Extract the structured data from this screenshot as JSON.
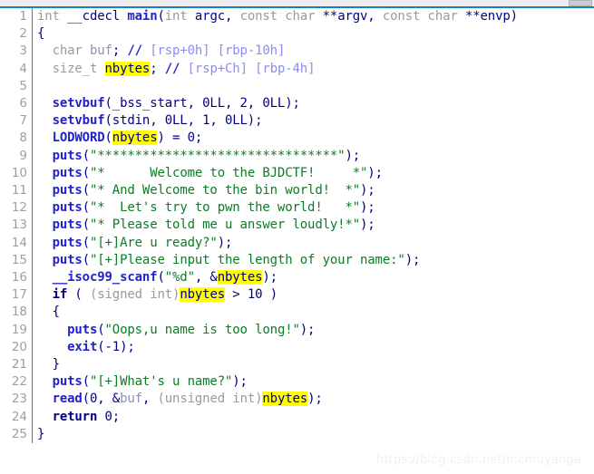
{
  "window": {
    "scrollbar_present": true,
    "accent_color": "#1a7fc1",
    "gutter_divider_color": "#3f7fd0",
    "highlight_color": "#ffff00",
    "background_color": "#ffffff"
  },
  "watermark": {
    "text": "https://blog.csdn.net/mcmuyanga"
  },
  "editor": {
    "highlighted_token": "nbytes",
    "line_count": 25,
    "lines": [
      {
        "number": "1",
        "text": "int __cdecl main(int argc, const char **argv, const char **envp)"
      },
      {
        "number": "2",
        "text": "{"
      },
      {
        "number": "3",
        "text": "  char buf; // [rsp+0h] [rbp-10h]"
      },
      {
        "number": "4",
        "text": "  size_t nbytes; // [rsp+Ch] [rbp-4h]"
      },
      {
        "number": "5",
        "text": ""
      },
      {
        "number": "6",
        "text": "  setvbuf(_bss_start, 0LL, 2, 0LL);"
      },
      {
        "number": "7",
        "text": "  setvbuf(stdin, 0LL, 1, 0LL);"
      },
      {
        "number": "8",
        "text": "  LODWORD(nbytes) = 0;"
      },
      {
        "number": "9",
        "text": "  puts(\"********************************\");"
      },
      {
        "number": "10",
        "text": "  puts(\"*      Welcome to the BJDCTF!     *\");"
      },
      {
        "number": "11",
        "text": "  puts(\"* And Welcome to the bin world!  *\");"
      },
      {
        "number": "12",
        "text": "  puts(\"*  Let's try to pwn the world!   *\");"
      },
      {
        "number": "13",
        "text": "  puts(\"* Please told me u answer loudly!*\");"
      },
      {
        "number": "14",
        "text": "  puts(\"[+]Are u ready?\");"
      },
      {
        "number": "15",
        "text": "  puts(\"[+]Please input the length of your name:\");"
      },
      {
        "number": "16",
        "text": "  __isoc99_scanf(\"%d\", &nbytes);"
      },
      {
        "number": "17",
        "text": "  if ( (signed int)nbytes > 10 )"
      },
      {
        "number": "18",
        "text": "  {"
      },
      {
        "number": "19",
        "text": "    puts(\"Oops,u name is too long!\");"
      },
      {
        "number": "20",
        "text": "    exit(-1);"
      },
      {
        "number": "21",
        "text": "  }"
      },
      {
        "number": "22",
        "text": "  puts(\"[+]What's u name?\");"
      },
      {
        "number": "23",
        "text": "  read(0, &buf, (unsigned int)nbytes);"
      },
      {
        "number": "24",
        "text": "  return 0;"
      },
      {
        "number": "25",
        "text": "}"
      }
    ],
    "numbers": [
      "1",
      "2",
      "3",
      "4",
      "5",
      "6",
      "7",
      "8",
      "9",
      "10",
      "11",
      "12",
      "13",
      "14",
      "15",
      "16",
      "17",
      "18",
      "19",
      "20",
      "21",
      "22",
      "23",
      "24",
      "25"
    ],
    "strings": [
      "********************************",
      "*      Welcome to the BJDCTF!     *",
      "* And Welcome to the bin world!  *",
      "*  Let's try to pwn the world!   *",
      "* Please told me u answer loudly!*",
      "[+]Are u ready?",
      "[+]Please input the length of your name:",
      "%d",
      "Oops,u name is too long!",
      "[+]What's u name?"
    ],
    "comments": [
      "// [rsp+0h] [rbp-10h]",
      "// [rsp+Ch] [rbp-4h]"
    ],
    "identifiers": [
      "main",
      "argc",
      "argv",
      "envp",
      "buf",
      "nbytes",
      "setvbuf",
      "_bss_start",
      "stdin",
      "LODWORD",
      "puts",
      "__isoc99_scanf",
      "exit",
      "read"
    ],
    "tokens": {
      "l1_a": "int __cdecl main(",
      "l1_b": "int",
      "l1_c": " argc, ",
      "l1_d": "const char",
      "l1_e": " **argv, ",
      "l1_f": "const char",
      "l1_g": " **envp)",
      "l2": "{",
      "l3_indent": "  ",
      "l3_type": "char",
      "l3_sp": " ",
      "l3_var": "buf",
      "l3_semi": "; ",
      "l3_slash": "//",
      "l3_cmt": " [rsp+0h] [rbp-10h]",
      "l4_indent": "  ",
      "l4_type": "size_t",
      "l4_sp": " ",
      "l4_hl": "nbytes",
      "l4_semi": "; ",
      "l4_slash": "//",
      "l4_cmt": " [rsp+Ch] [rbp-4h]",
      "l6_fn": "setvbuf",
      "l6_args": "(_bss_start, 0LL, 2, 0LL);",
      "l7_fn": "setvbuf",
      "l7_args": "(stdin, 0LL, 1, 0LL);",
      "l8_fn": "LODWORD",
      "l8_open": "(",
      "l8_hl": "nbytes",
      "l8_rest": ") = 0;",
      "l9_fn": "puts",
      "l9_open": "(",
      "l9_str": "\"********************************\"",
      "l9_close": ");",
      "l10_fn": "puts",
      "l10_str": "\"*      Welcome to the BJDCTF!     *\"",
      "l11_fn": "puts",
      "l11_str": "\"* And Welcome to the bin world!  *\"",
      "l12_fn": "puts",
      "l12_str": "\"*  Let's try to pwn the world!   *\"",
      "l13_fn": "puts",
      "l13_str": "\"* Please told me u answer loudly!*\"",
      "l14_fn": "puts",
      "l14_str": "\"[+]Are u ready?\"",
      "l15_fn": "puts",
      "l15_str": "\"[+]Please input the length of your name:\"",
      "l16_fn": "__isoc99_scanf",
      "l16_open": "(",
      "l16_str": "\"%d\"",
      "l16_mid": ", &",
      "l16_hl": "nbytes",
      "l16_close": ");",
      "l17_kw": "if",
      "l17_open": " ( ",
      "l17_cast": "(signed int)",
      "l17_hl": "nbytes",
      "l17_rest": " > 10 )",
      "l18": "{",
      "l19_fn": "puts",
      "l19_open": "(",
      "l19_str": "\"Oops,u name is too long!\"",
      "l19_close": ");",
      "l20_fn": "exit",
      "l20_args": "(-1);",
      "l21": "}",
      "l22_fn": "puts",
      "l22_open": "(",
      "l22_str": "\"[+]What's u name?\"",
      "l22_close": ");",
      "l23_fn": "read",
      "l23_open": "(0, &",
      "l23_var": "buf",
      "l23_mid": ", ",
      "l23_cast": "(unsigned int)",
      "l23_hl": "nbytes",
      "l23_close": ");",
      "l24_kw": "return",
      "l24_rest": " 0;",
      "l25": "}",
      "indent2": "  ",
      "indent4": "    ",
      "empty": ""
    }
  }
}
